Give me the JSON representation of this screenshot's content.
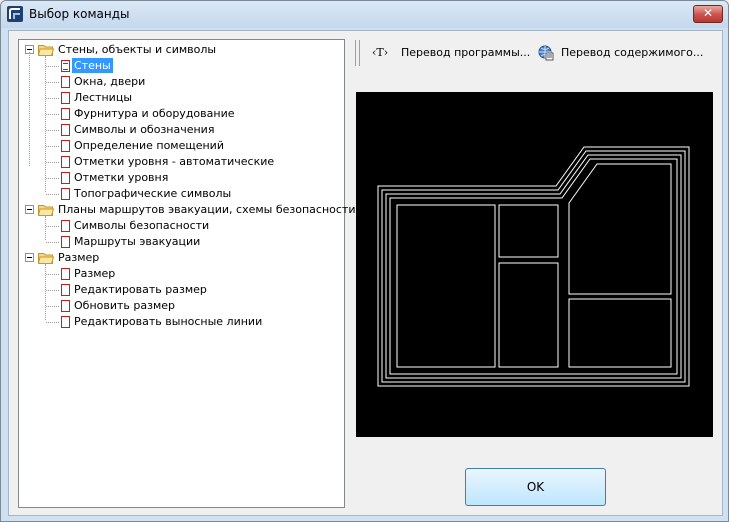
{
  "window": {
    "title": "Выбор команды",
    "close_glyph": "✕"
  },
  "tree": {
    "groups": [
      {
        "label": "Стены, объекты и символы",
        "items": [
          "Стены",
          "Окна, двери",
          "Лестницы",
          "Фурнитура и оборудование",
          "Символы и обозначения",
          "Определение помещений",
          "Отметки уровня - автоматические",
          "Отметки уровня",
          "Топографические символы"
        ]
      },
      {
        "label": "Планы маршрутов эвакуации, схемы безопасности",
        "items": [
          "Символы безопасности",
          "Маршруты эвакуации"
        ]
      },
      {
        "label": "Размер",
        "items": [
          "Размер",
          "Редактировать размер",
          "Обновить размер",
          "Редактировать выносные линии"
        ]
      }
    ],
    "selected_item": "Стены"
  },
  "toolbar": {
    "translate_program": {
      "label": "Перевод программы...",
      "icon": "text-T-icon",
      "glyph": "‹T›"
    },
    "translate_content": {
      "label": "Перевод содержимого...",
      "icon": "globe-translate-icon"
    }
  },
  "preview": {
    "background": "#000000",
    "stroke": "#ffffff"
  },
  "ok_button": {
    "label": "OK"
  }
}
